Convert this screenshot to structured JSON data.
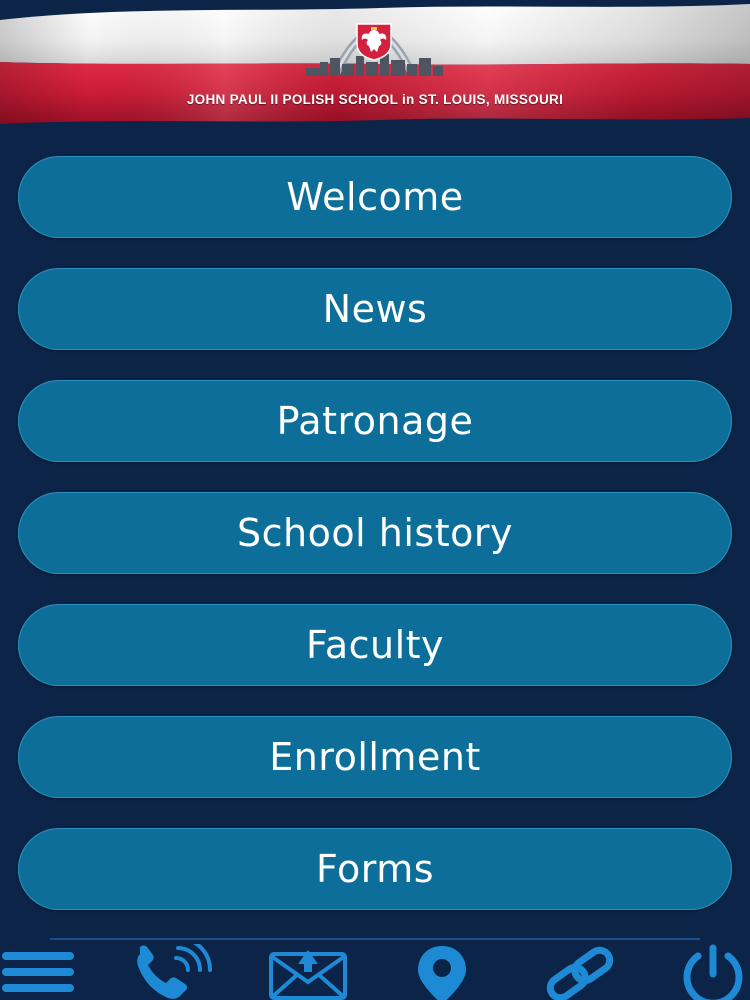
{
  "header": {
    "title": "JOHN PAUL II POLISH SCHOOL in ST. LOUIS, MISSOURI",
    "logo_icon": "polish-eagle-arch-logo-icon"
  },
  "menu": {
    "items": [
      {
        "label": "Welcome"
      },
      {
        "label": "News"
      },
      {
        "label": "Patronage"
      },
      {
        "label": "School history"
      },
      {
        "label": "Faculty"
      },
      {
        "label": "Enrollment"
      },
      {
        "label": "Forms"
      }
    ]
  },
  "bottom_bar": {
    "icons": [
      "menu-icon",
      "phone-icon",
      "mail-icon",
      "location-pin-icon",
      "link-icon",
      "power-icon"
    ]
  },
  "colors": {
    "background": "#0b2447",
    "button": "#0d6e99",
    "icon": "#1e8ad6",
    "flag_white": "#ffffff",
    "flag_red": "#d4213d"
  }
}
